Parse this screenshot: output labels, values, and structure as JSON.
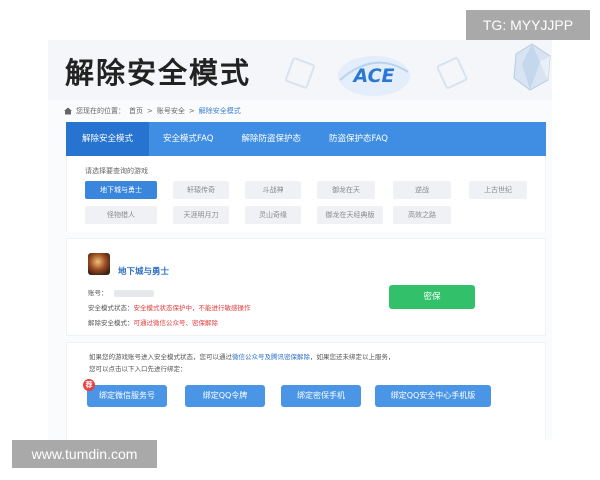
{
  "watermark_top": "TG: MYYJJPP",
  "watermark_bottom": "www.tumdin.com",
  "hero": {
    "title": "解除安全模式",
    "logo_text": "ACE"
  },
  "breadcrumb": {
    "prefix": "您现在的位置：",
    "home": "首页",
    "section": "账号安全",
    "current": "解除安全模式"
  },
  "tabs": [
    "解除安全模式",
    "安全模式FAQ",
    "解除防盗保护态",
    "防盗保护态FAQ"
  ],
  "games_panel": {
    "label": "请选择要查询的游戏",
    "games": [
      "地下城与勇士",
      "轩辕传奇",
      "斗战神",
      "御龙在天",
      "逆战",
      "上古世纪",
      "怪物猎人",
      "天涯明月刀",
      "灵山奇缘",
      "御龙在天经典版",
      "高效之路"
    ]
  },
  "account": {
    "game_name": "地下城与勇士",
    "account_label": "账号：",
    "status_label": "安全模式状态：",
    "status_value": "安全模式状态保护中，不能进行敏感操作",
    "unlock_label": "解除安全模式：",
    "unlock_value": "可通过微信公众号、密保解除",
    "protect_button": "密保"
  },
  "bottom": {
    "note1_a": "如果您的游戏账号进入安全模式状态，您可以通过",
    "note1_link": "微信公众号及腾讯密保解除",
    "note1_b": "，如果您还未绑定以上服务，",
    "note2": "您可以点击以下入口先进行绑定：",
    "badge": "荐",
    "buttons": [
      "绑定微信服务号",
      "绑定QQ令牌",
      "绑定密保手机",
      "绑定QQ安全中心手机版"
    ]
  },
  "colors": {
    "tab_bar": "#3f8ee3",
    "tab_active": "#2674cf",
    "protect_green": "#33c06a",
    "bind_blue": "#4a95e6",
    "warn_red": "#e23b3b"
  }
}
